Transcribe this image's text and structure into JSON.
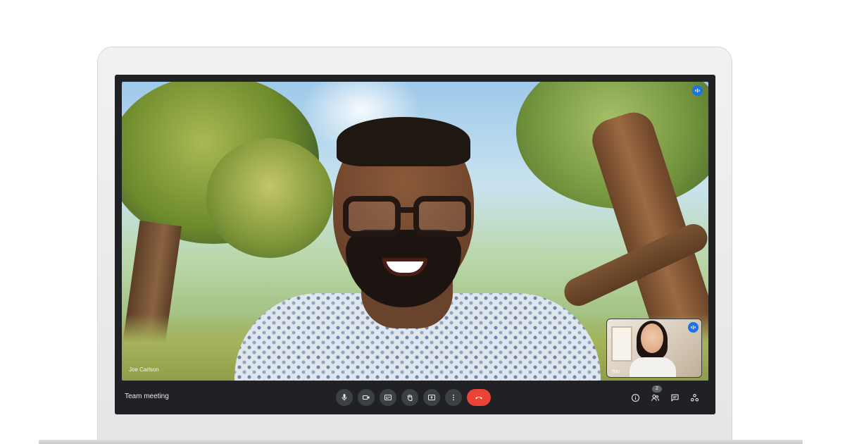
{
  "meeting": {
    "title": "Team meeting"
  },
  "participants": {
    "main": {
      "name": "Joe Carlson"
    },
    "self": {
      "name": "You"
    }
  },
  "controls": {
    "center": [
      "microphone-icon",
      "camera-icon",
      "captions-icon",
      "raise-hand-icon",
      "present-screen-icon",
      "more-options-icon",
      "hang-up-icon"
    ],
    "right": [
      "meeting-info-icon",
      "people-icon",
      "chat-icon",
      "activities-icon"
    ],
    "people_count": "2"
  },
  "colors": {
    "bar_background": "#202124",
    "button_background": "#3c4043",
    "hang_up": "#ea4335",
    "speaking_indicator": "#1a73e8"
  }
}
